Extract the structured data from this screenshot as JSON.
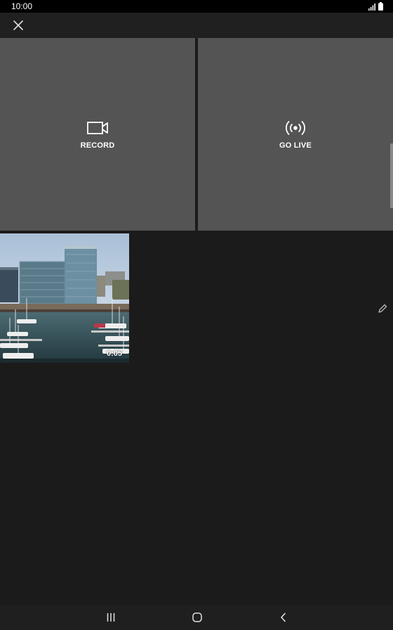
{
  "status_bar": {
    "time": "10:00"
  },
  "toolbar": {
    "close_icon": "close-icon"
  },
  "actions": {
    "record": {
      "label": "RECORD",
      "icon": "video-camera-icon"
    },
    "live": {
      "label": "GO LIVE",
      "icon": "broadcast-icon"
    }
  },
  "media": {
    "items": [
      {
        "duration": "0:05",
        "kind": "video"
      }
    ]
  },
  "side_controls": {
    "edit_icon": "pencil-icon"
  },
  "nav_bar": {
    "recents_icon": "recents-icon",
    "home_icon": "home-icon",
    "back_icon": "back-icon"
  },
  "colors": {
    "background": "#1b1b1b",
    "tile": "#545454",
    "toolbar": "#202020",
    "status_bar": "#000000"
  }
}
